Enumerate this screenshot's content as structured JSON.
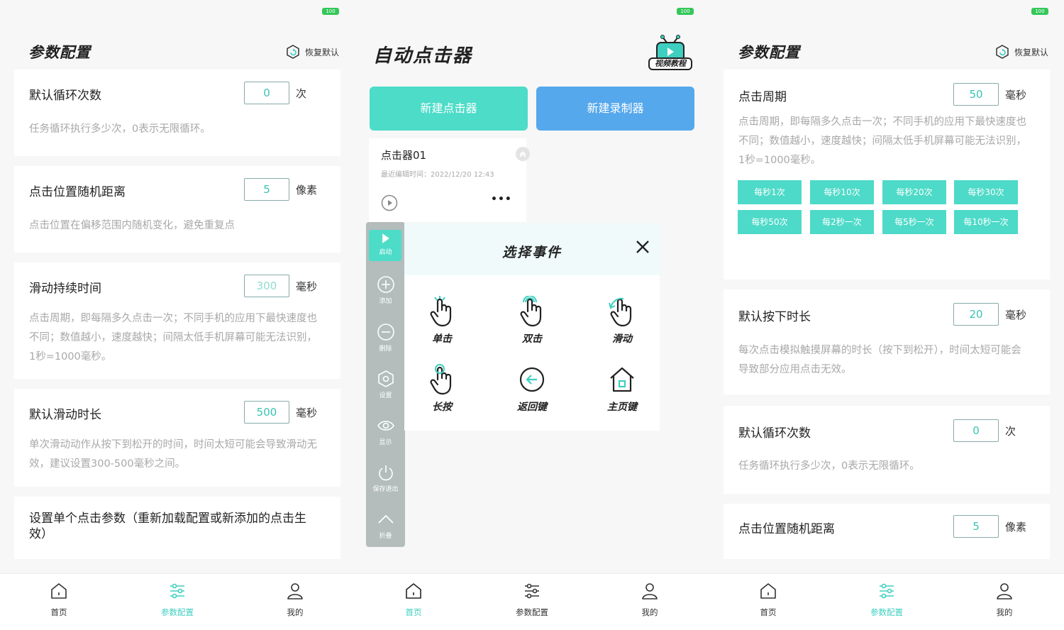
{
  "colors": {
    "accent": "#3ecfc0",
    "teal_btn": "#4ddcc8",
    "blue_btn": "#56a8ec",
    "chip": "#4ddac8"
  },
  "status": {
    "battery": "100"
  },
  "panel1": {
    "title": "参数配置",
    "restore": "恢复默认",
    "cards": [
      {
        "title": "默认循环次数",
        "value": "0",
        "unit": "次",
        "desc": "任务循环执行多少次，0表示无限循环。"
      },
      {
        "title": "点击位置随机距离",
        "value": "5",
        "unit": "像素",
        "desc": "点击位置在偏移范围内随机变化，避免重复点"
      },
      {
        "title": "滑动持续时间",
        "value": "300",
        "unit": "毫秒",
        "desc": "点击周期，即每隔多久点击一次；不同手机的应用下最快速度也不同；数值越小，速度越快；间隔太低手机屏幕可能无法识别，1秒=1000毫秒。"
      },
      {
        "title": "默认滑动时长",
        "value": "500",
        "unit": "毫秒",
        "desc": "单次滑动动作从按下到松开的时间，时间太短可能会导致滑动无效，建议设置300-500毫秒之间。"
      },
      {
        "title": "设置单个点击参数（重新加载配置或新添加的点击生效）"
      }
    ]
  },
  "panel2": {
    "title": "自动点击器",
    "badge": "视频教程",
    "new_clicker": "新建点击器",
    "new_recorder": "新建录制器",
    "clicker": {
      "name": "点击器01",
      "edited": "最近编辑时间：2022/12/20 12:43",
      "more": "•••"
    },
    "float_menu": [
      "启动",
      "添加",
      "删除",
      "设置",
      "显示",
      "保存退出",
      "折叠"
    ],
    "dialog": {
      "title": "选择事件",
      "events": [
        "单击",
        "双击",
        "滑动",
        "长按",
        "返回键",
        "主页键"
      ]
    }
  },
  "panel3": {
    "title": "参数配置",
    "restore": "恢复默认",
    "period": {
      "title": "点击周期",
      "value": "50",
      "unit": "毫秒",
      "desc": "点击周期，即每隔多久点击一次；不同手机的应用下最快速度也不同；数值越小，速度越快；间隔太低手机屏幕可能无法识别，1秒=1000毫秒。"
    },
    "chips": [
      "每秒1次",
      "每秒10次",
      "每秒20次",
      "每秒30次",
      "每秒50次",
      "每2秒一次",
      "每5秒一次",
      "每10秒一次"
    ],
    "press": {
      "title": "默认按下时长",
      "value": "20",
      "unit": "毫秒",
      "desc": "每次点击模拟触摸屏幕的时长（按下到松开），时间太短可能会导致部分应用点击无效。"
    },
    "loop": {
      "title": "默认循环次数",
      "value": "0",
      "unit": "次",
      "desc": "任务循环执行多少次，0表示无限循环。"
    },
    "random": {
      "title": "点击位置随机距离",
      "value": "5",
      "unit": "像素"
    }
  },
  "tabs": [
    "首页",
    "参数配置",
    "我的"
  ]
}
